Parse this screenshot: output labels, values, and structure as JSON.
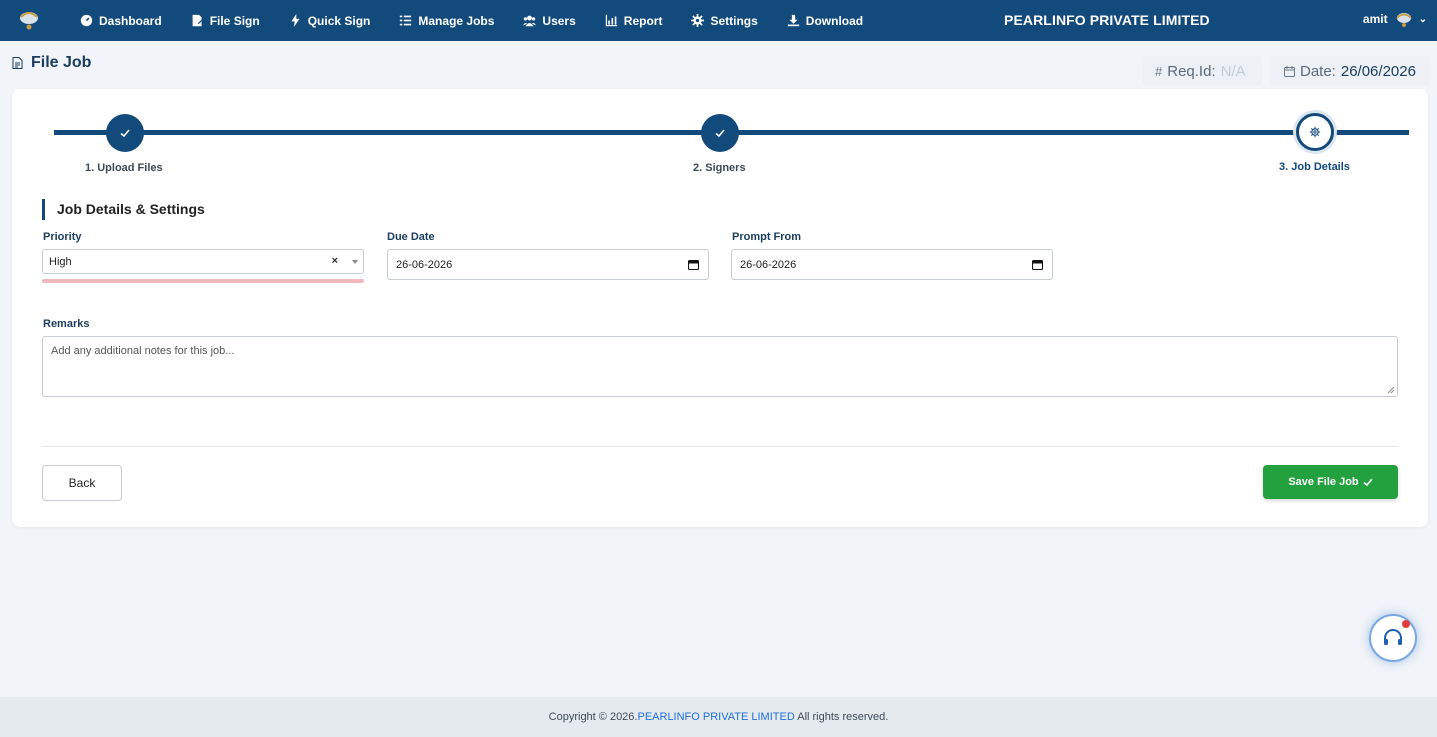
{
  "nav": {
    "items": [
      {
        "label": "Dashboard",
        "icon": "dashboard-icon"
      },
      {
        "label": "File Sign",
        "icon": "file-sign-icon"
      },
      {
        "label": "Quick Sign",
        "icon": "bolt-icon"
      },
      {
        "label": "Manage Jobs",
        "icon": "list-check-icon"
      },
      {
        "label": "Users",
        "icon": "users-icon"
      },
      {
        "label": "Report",
        "icon": "chart-icon"
      },
      {
        "label": "Settings",
        "icon": "gear-icon"
      },
      {
        "label": "Download",
        "icon": "download-icon"
      }
    ],
    "brand": "PEARLINFO PRIVATE LIMITED",
    "user": "amit"
  },
  "page": {
    "title": "File Job",
    "req_label": "Req.Id:",
    "req_value": "N/A",
    "date_label": "Date:",
    "date_value": "26/06/2026"
  },
  "stepper": {
    "steps": [
      {
        "label": "1. Upload Files",
        "status": "completed"
      },
      {
        "label": "2. Signers",
        "status": "completed"
      },
      {
        "label": "3. Job Details",
        "status": "active"
      }
    ]
  },
  "form": {
    "section_title": "Job Details & Settings",
    "priority_label": "Priority",
    "priority_value": "High",
    "priority_clear": "×",
    "due_date_label": "Due Date",
    "due_date_value": "26-06-2026",
    "prompt_from_label": "Prompt From",
    "prompt_from_value": "26-06-2026",
    "remarks_label": "Remarks",
    "remarks_placeholder": "Add any additional notes for this job...",
    "back_label": "Back",
    "save_label": "Save File Job"
  },
  "footer": {
    "prefix": "Copyright © 2026.",
    "brand": "PEARLINFO PRIVATE LIMITED",
    "suffix": " All rights reserved."
  },
  "colors": {
    "navbar": "#134a7c",
    "primary": "#134a7c",
    "save_button": "#23a13e",
    "error_underline": "#f1b9bd",
    "notification_dot": "#e23b3b"
  }
}
